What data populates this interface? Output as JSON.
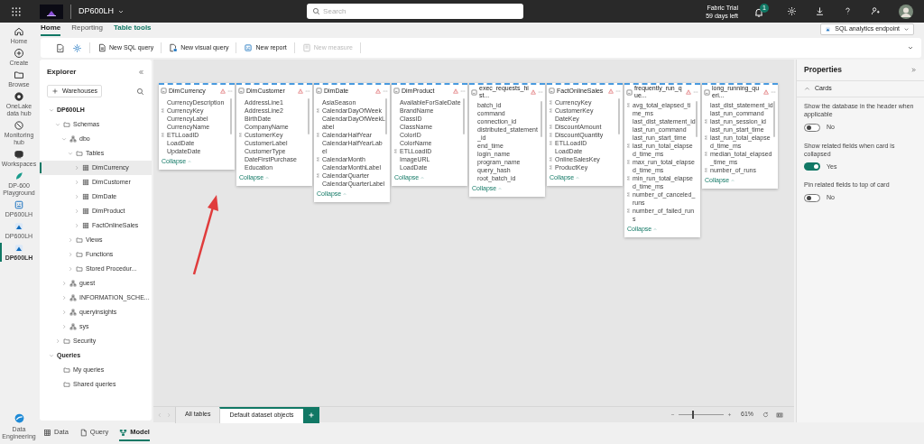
{
  "top_bar": {
    "workspace": "DP600LH",
    "search": {
      "placeholder": "Search"
    },
    "trial": {
      "title": "Fabric Trial",
      "days": "59 days left"
    },
    "notification_count": "1"
  },
  "nav": {
    "items": [
      {
        "label": "Home",
        "selected": false
      },
      {
        "label": "Create",
        "selected": false
      },
      {
        "label": "Browse",
        "selected": false
      },
      {
        "label": "OneLake data hub",
        "selected": false
      },
      {
        "label": "Monitoring hub",
        "selected": false
      },
      {
        "label": "Workspaces",
        "selected": false
      },
      {
        "label": "DP-600 Playground",
        "selected": false
      },
      {
        "label": "DP600LH",
        "selected": false
      },
      {
        "label": "DP600LH",
        "selected": false
      },
      {
        "label": "DP600LH",
        "selected": true
      }
    ],
    "bottom": {
      "label": "Data Engineering"
    }
  },
  "ribbon": {
    "tabs": [
      {
        "label": "Home",
        "selected": true
      },
      {
        "label": "Reporting",
        "selected": false
      },
      {
        "label": "Table tools",
        "selected": false
      }
    ],
    "endpoint": "SQL analytics endpoint",
    "actions": [
      {
        "label": "New SQL query",
        "disabled": false
      },
      {
        "label": "New visual query",
        "disabled": false
      },
      {
        "label": "New report",
        "disabled": false
      },
      {
        "label": "New measure",
        "disabled": true
      }
    ]
  },
  "explorer": {
    "title": "Explorer",
    "add_button": "Warehouses",
    "tree": [
      {
        "label": "DP600LH",
        "expanded": true,
        "selected": false,
        "children": [
          {
            "label": "Schemas",
            "kind": "folder",
            "expanded": true,
            "selected": false,
            "children": [
              {
                "label": "dbo",
                "kind": "schema",
                "expanded": true,
                "selected": false,
                "children": [
                  {
                    "label": "Tables",
                    "kind": "folder",
                    "expanded": true,
                    "selected": false,
                    "children": [
                      {
                        "label": "DimCurrency",
                        "kind": "table",
                        "expanded": false,
                        "selected": true
                      },
                      {
                        "label": "DimCustomer",
                        "kind": "table",
                        "expanded": false,
                        "selected": false
                      },
                      {
                        "label": "DimDate",
                        "kind": "table",
                        "expanded": false,
                        "selected": false
                      },
                      {
                        "label": "DimProduct",
                        "kind": "table",
                        "expanded": false,
                        "selected": false
                      },
                      {
                        "label": "FactOnlineSales",
                        "kind": "table",
                        "expanded": false,
                        "selected": false
                      }
                    ]
                  },
                  {
                    "label": "Views",
                    "kind": "folder",
                    "expanded": false,
                    "selected": false
                  },
                  {
                    "label": "Functions",
                    "kind": "folder",
                    "expanded": false,
                    "selected": false
                  },
                  {
                    "label": "Stored Procedur...",
                    "kind": "folder",
                    "expanded": false,
                    "selected": false
                  }
                ]
              },
              {
                "label": "guest",
                "kind": "schema",
                "expanded": false,
                "selected": false
              },
              {
                "label": "INFORMATION_SCHE...",
                "kind": "schema",
                "expanded": false,
                "selected": false
              },
              {
                "label": "queryinsights",
                "kind": "schema",
                "expanded": false,
                "selected": false
              },
              {
                "label": "sys",
                "kind": "schema",
                "expanded": false,
                "selected": false
              }
            ]
          },
          {
            "label": "Security",
            "kind": "folder",
            "expanded": false,
            "selected": false
          }
        ]
      },
      {
        "label": "Queries",
        "expanded": true,
        "selected": false,
        "children": [
          {
            "label": "My queries",
            "kind": "folder",
            "selected": false
          },
          {
            "label": "Shared queries",
            "kind": "folder",
            "selected": false
          }
        ]
      }
    ]
  },
  "cards": [
    {
      "title": "DimCurrency",
      "warning": true,
      "collapse": "Collapse",
      "fields": [
        {
          "name": "CurrencyDescription",
          "sum": false
        },
        {
          "name": "CurrencyKey",
          "sum": true
        },
        {
          "name": "CurrencyLabel",
          "sum": false
        },
        {
          "name": "CurrencyName",
          "sum": false
        },
        {
          "name": "ETLLoadID",
          "sum": true
        },
        {
          "name": "LoadDate",
          "sum": false
        },
        {
          "name": "UpdateDate",
          "sum": false
        }
      ]
    },
    {
      "title": "DimCustomer",
      "warning": true,
      "collapse": "Collapse",
      "fields": [
        {
          "name": "AddressLine1",
          "sum": false
        },
        {
          "name": "AddressLine2",
          "sum": false
        },
        {
          "name": "BirthDate",
          "sum": false
        },
        {
          "name": "CompanyName",
          "sum": false
        },
        {
          "name": "CustomerKey",
          "sum": true
        },
        {
          "name": "CustomerLabel",
          "sum": false
        },
        {
          "name": "CustomerType",
          "sum": false
        },
        {
          "name": "DateFirstPurchase",
          "sum": false
        },
        {
          "name": "Education",
          "sum": false
        }
      ]
    },
    {
      "title": "DimDate",
      "warning": true,
      "collapse": "Collapse",
      "fields": [
        {
          "name": "AsiaSeason",
          "sum": false
        },
        {
          "name": "CalendarDayOfWeek",
          "sum": true
        },
        {
          "name": "CalendarDayOfWeekLabel",
          "sum": false
        },
        {
          "name": "CalendarHalfYear",
          "sum": true
        },
        {
          "name": "CalendarHalfYearLabel",
          "sum": false
        },
        {
          "name": "CalendarMonth",
          "sum": true
        },
        {
          "name": "CalendarMonthLabel",
          "sum": false
        },
        {
          "name": "CalendarQuarter",
          "sum": true
        },
        {
          "name": "CalendarQuarterLabel",
          "sum": false
        }
      ]
    },
    {
      "title": "DimProduct",
      "warning": true,
      "collapse": "Collapse",
      "fields": [
        {
          "name": "AvailableForSaleDate",
          "sum": false
        },
        {
          "name": "BrandName",
          "sum": false
        },
        {
          "name": "ClassID",
          "sum": false
        },
        {
          "name": "ClassName",
          "sum": false
        },
        {
          "name": "ColorID",
          "sum": false
        },
        {
          "name": "ColorName",
          "sum": false
        },
        {
          "name": "ETLLoadID",
          "sum": true
        },
        {
          "name": "ImageURL",
          "sum": false
        },
        {
          "name": "LoadDate",
          "sum": false
        }
      ]
    },
    {
      "title": "exec_requests_hist...",
      "warning": true,
      "collapse": "Collapse",
      "fields": [
        {
          "name": "batch_id",
          "sum": false
        },
        {
          "name": "command",
          "sum": false
        },
        {
          "name": "connection_id",
          "sum": false
        },
        {
          "name": "distributed_statement_id",
          "sum": false
        },
        {
          "name": "end_time",
          "sum": false
        },
        {
          "name": "login_name",
          "sum": false
        },
        {
          "name": "program_name",
          "sum": false
        },
        {
          "name": "query_hash",
          "sum": false
        },
        {
          "name": "root_batch_id",
          "sum": false
        }
      ]
    },
    {
      "title": "FactOnlineSales",
      "warning": true,
      "collapse": "Collapse",
      "fields": [
        {
          "name": "CurrencyKey",
          "sum": true
        },
        {
          "name": "CustomerKey",
          "sum": true
        },
        {
          "name": "DateKey",
          "sum": false
        },
        {
          "name": "DiscountAmount",
          "sum": true
        },
        {
          "name": "DiscountQuantity",
          "sum": true
        },
        {
          "name": "ETLLoadID",
          "sum": true
        },
        {
          "name": "LoadDate",
          "sum": false
        },
        {
          "name": "OnlineSalesKey",
          "sum": true
        },
        {
          "name": "ProductKey",
          "sum": true
        }
      ]
    },
    {
      "title": "frequently_run_que...",
      "warning": true,
      "collapse": "Collapse",
      "fields": [
        {
          "name": "avg_total_elapsed_time_ms",
          "sum": true
        },
        {
          "name": "last_dist_statement_id",
          "sum": false
        },
        {
          "name": "last_run_command",
          "sum": false
        },
        {
          "name": "last_run_start_time",
          "sum": false
        },
        {
          "name": "last_run_total_elapsed_time_ms",
          "sum": true
        },
        {
          "name": "max_run_total_elapsed_time_ms",
          "sum": true
        },
        {
          "name": "min_run_total_elapsed_time_ms",
          "sum": true
        },
        {
          "name": "number_of_canceled_runs",
          "sum": true
        },
        {
          "name": "number_of_failed_runs",
          "sum": true
        }
      ]
    },
    {
      "title": "long_running_queri...",
      "warning": true,
      "collapse": "Collapse",
      "fields": [
        {
          "name": "last_dist_statement_id",
          "sum": false
        },
        {
          "name": "last_run_command",
          "sum": false
        },
        {
          "name": "last_run_session_id",
          "sum": true
        },
        {
          "name": "last_run_start_time",
          "sum": false
        },
        {
          "name": "last_run_total_elapsed_time_ms",
          "sum": true
        },
        {
          "name": "median_total_elapsed_time_ms",
          "sum": true
        },
        {
          "name": "number_of_runs",
          "sum": true
        }
      ]
    }
  ],
  "canvas_tabs": [
    {
      "label": "All tables",
      "selected": false
    },
    {
      "label": "Default dataset objects",
      "selected": true
    }
  ],
  "zoom": {
    "level": 0.3,
    "reading": "61%"
  },
  "properties": {
    "title": "Properties",
    "section": {
      "label": "Cards",
      "expanded": true
    },
    "settings": [
      {
        "label": "Show the database in the header when applicable",
        "on": false,
        "state": "No"
      },
      {
        "label": "Show related fields when card is collapsed",
        "on": true,
        "state": "Yes"
      },
      {
        "label": "Pin related fields to top of card",
        "on": false,
        "state": "No"
      }
    ]
  },
  "views": [
    {
      "label": "Data",
      "selected": false
    },
    {
      "label": "Query",
      "selected": false
    },
    {
      "label": "Model",
      "selected": true
    }
  ]
}
